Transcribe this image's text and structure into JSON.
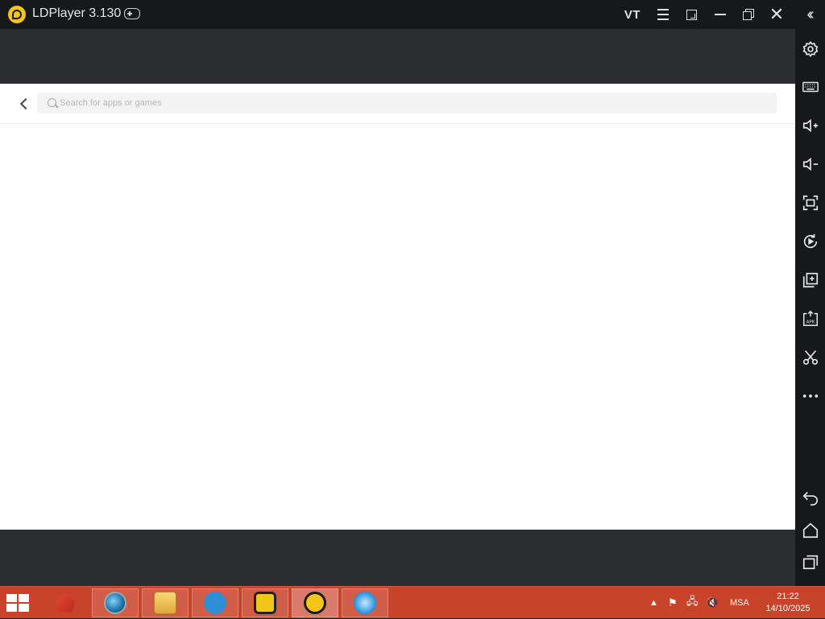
{
  "window": {
    "title": "LDPlayer 3.130",
    "vt_label": "VT"
  },
  "search": {
    "placeholder": "Search for apps or games",
    "value": ""
  },
  "sidebar": {
    "items": [
      "settings-icon",
      "keyboard-icon",
      "volume-up-icon",
      "volume-down-icon",
      "fullscreen-icon",
      "rotate-icon",
      "multi-instance-icon",
      "apk-install-icon",
      "screenshot-scissors-icon",
      "more-icon",
      "back-icon",
      "home-icon",
      "recent-apps-icon"
    ],
    "apk_label": "APK"
  },
  "taskbar": {
    "apps": [
      "app-red-icon",
      "browser-globe-icon",
      "file-explorer-icon",
      "tool-wrench-icon",
      "yellow-box-app-icon",
      "ldplayer-icon",
      "internet-explorer-icon"
    ],
    "language": "MSA",
    "time": "21:22",
    "date": "14/10/2025"
  },
  "colors": {
    "titlebar": "#17181b",
    "screen_frame": "#2b2d31",
    "taskbar": "#c8432a",
    "accent": "#f5c518"
  }
}
